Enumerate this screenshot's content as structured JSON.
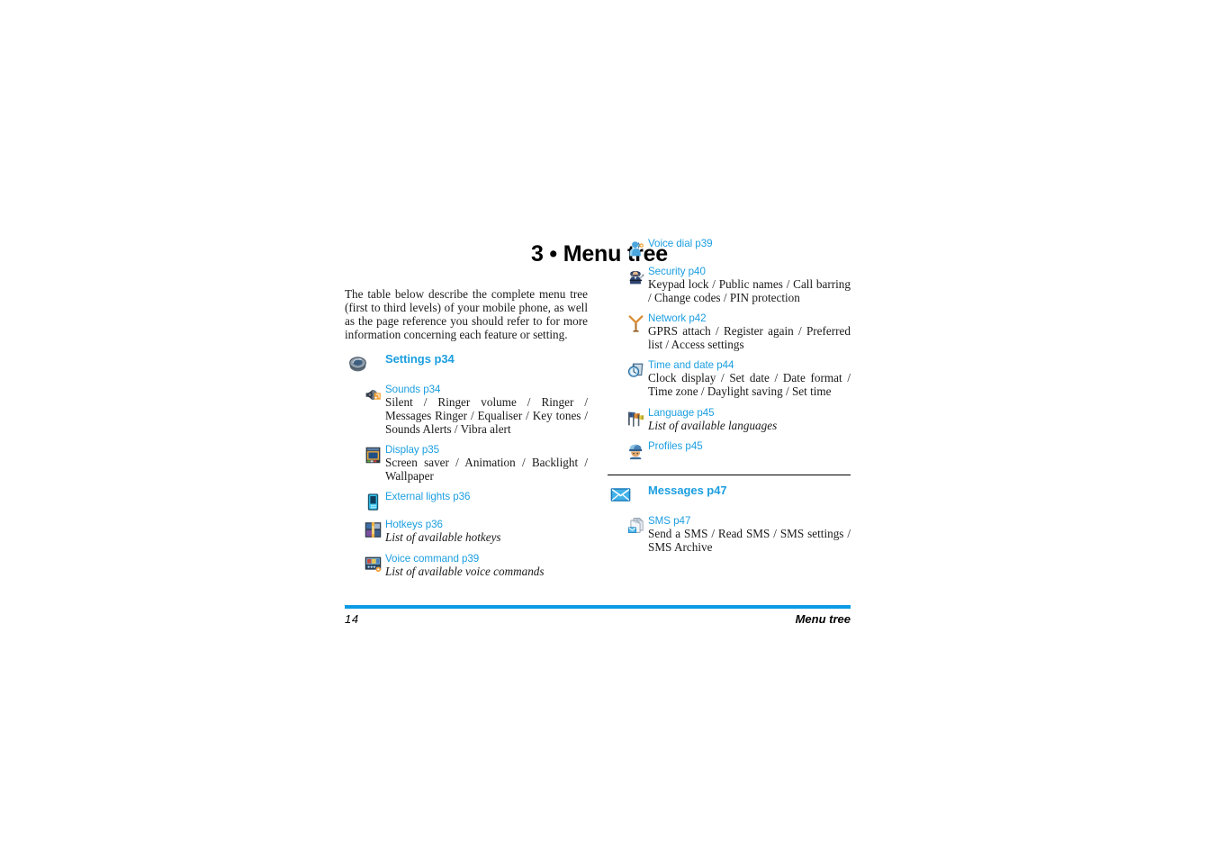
{
  "page": {
    "title": "3 • Menu tree",
    "intro": "The table below describe the complete menu tree (first to third levels) of your mobile phone, as well as the page reference you should refer to for more information concerning each feature or setting."
  },
  "left_column": {
    "entries": [
      {
        "level": 1,
        "icon": "settings-gear-icon",
        "title": "Settings p34",
        "description": ""
      },
      {
        "level": 2,
        "icon": "speaker-sounds-icon",
        "title": "Sounds p34",
        "description": "Silent / Ringer volume / Ringer / Messages Ringer / Equaliser / Key tones / Sounds Alerts / Vibra alert"
      },
      {
        "level": 2,
        "icon": "display-screen-icon",
        "title": "Display p35",
        "description": "Screen saver / Animation / Backlight / Wallpaper"
      },
      {
        "level": 2,
        "icon": "external-lights-icon",
        "title": "External lights p36",
        "description": ""
      },
      {
        "level": 2,
        "icon": "hotkeys-icon",
        "title": "Hotkeys p36",
        "description": "List of available hotkeys",
        "italic": true
      },
      {
        "level": 2,
        "icon": "voice-command-icon",
        "title": "Voice command p39",
        "description": "List of available voice commands",
        "italic": true
      }
    ]
  },
  "right_column": {
    "entries": [
      {
        "level": 2,
        "icon": "voice-dial-icon",
        "title": "Voice dial p39",
        "description": ""
      },
      {
        "level": 2,
        "icon": "security-guard-icon",
        "title": "Security p40",
        "description": "Keypad lock / Public names / Call barring / Change codes / PIN protection"
      },
      {
        "level": 2,
        "icon": "network-antenna-icon",
        "title": "Network p42",
        "description": "GPRS attach / Register again / Preferred list / Access settings"
      },
      {
        "level": 2,
        "icon": "clock-calendar-icon",
        "title": "Time and date p44",
        "description": "Clock display / Set date / Date format / Time zone / Daylight saving / Set time"
      },
      {
        "level": 2,
        "icon": "language-flags-icon",
        "title": "Language p45",
        "description": "List of available languages",
        "italic": true
      },
      {
        "level": 2,
        "icon": "profiles-icon",
        "title": "Profiles p45",
        "description": ""
      },
      {
        "level": 1,
        "icon": "envelope-messages-icon",
        "title": "Messages p47",
        "description": "",
        "rule_above": true
      },
      {
        "level": 2,
        "icon": "sms-icon",
        "title": "SMS p47",
        "description": "Send a SMS / Read SMS / SMS settings / SMS Archive"
      }
    ]
  },
  "footer": {
    "page_number": "14",
    "section": "Menu tree"
  },
  "colors": {
    "link_blue": "#1b9ee0",
    "rule_blue": "#0c9ae4",
    "text_black": "#1a1a1a"
  }
}
